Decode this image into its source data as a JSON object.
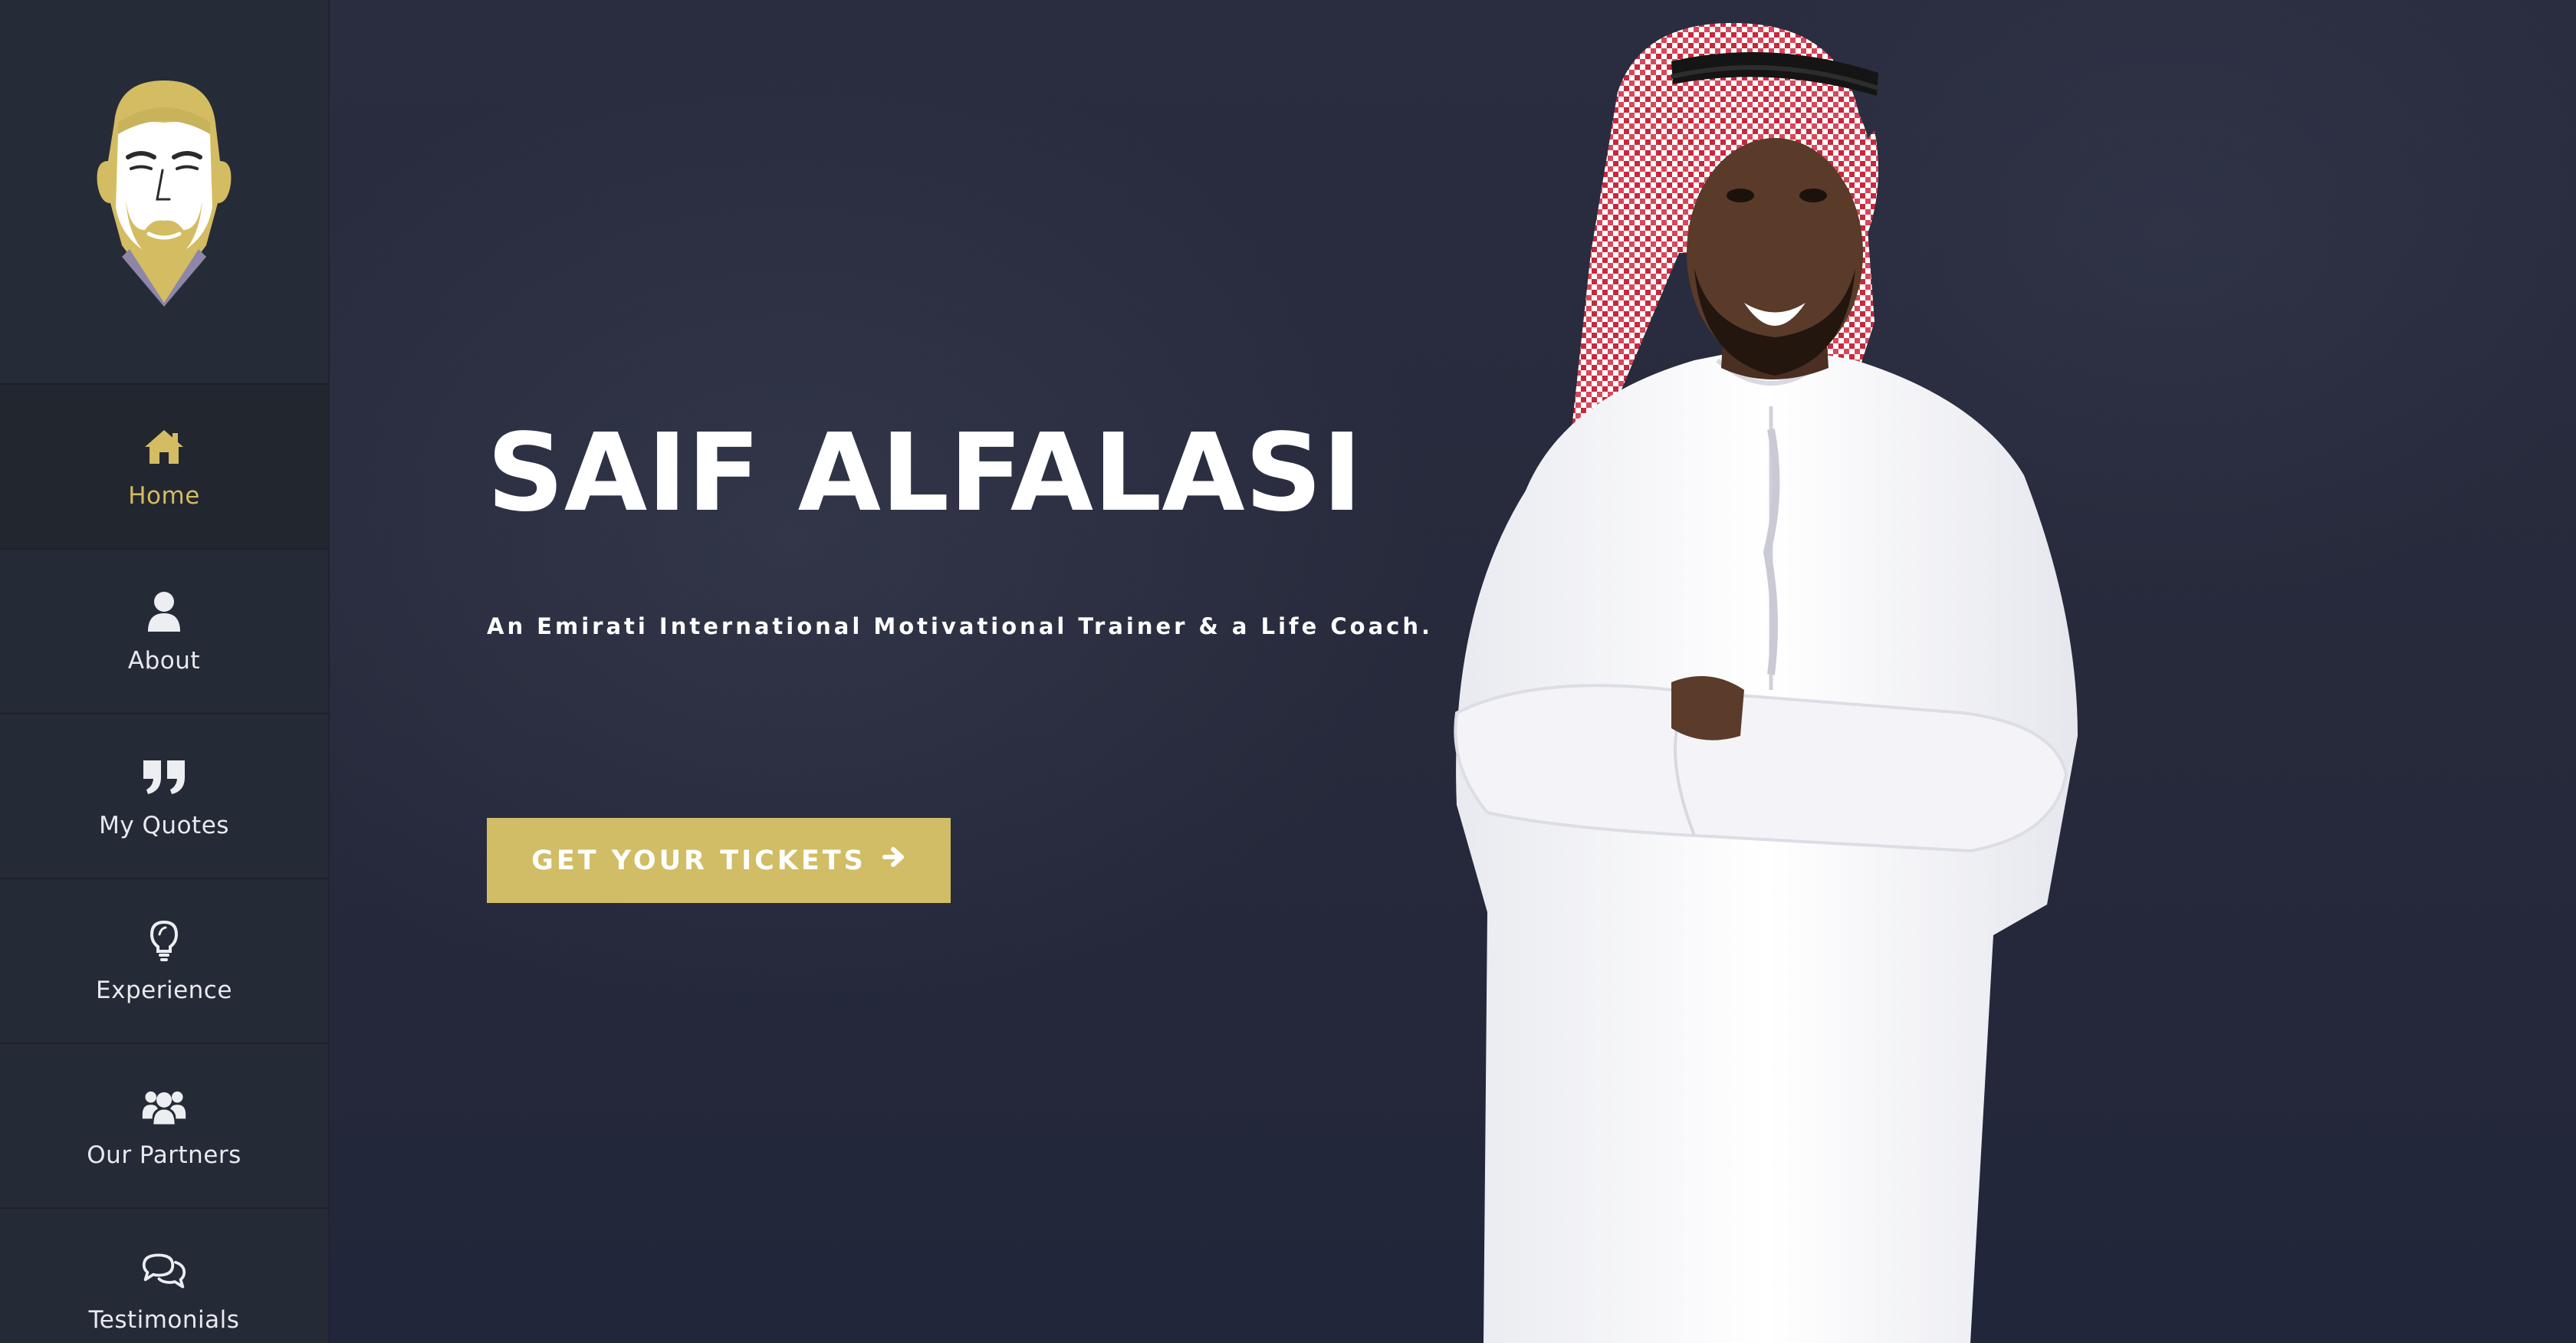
{
  "brand": {
    "logo_icon": "avatar-face-logo",
    "accent_color": "#d3bc62",
    "sidebar_bg": "#252a37"
  },
  "sidebar": {
    "items": [
      {
        "label": "Home",
        "icon": "home-icon",
        "active": true
      },
      {
        "label": "About",
        "icon": "user-icon",
        "active": false
      },
      {
        "label": "My Quotes",
        "icon": "quote-icon",
        "active": false
      },
      {
        "label": "Experience",
        "icon": "lightbulb-icon",
        "active": false
      },
      {
        "label": "Our Partners",
        "icon": "users-icon",
        "active": false
      },
      {
        "label": "Testimonials",
        "icon": "comments-icon",
        "active": false
      }
    ]
  },
  "hero": {
    "title": "SAIF ALFALASI",
    "subtitle": "An Emirati International Motivational Trainer & a Life Coach.",
    "cta_label": "GET YOUR TICKETS",
    "cta_icon": "arrow-right-icon",
    "cta_color": "#d1bd66"
  }
}
